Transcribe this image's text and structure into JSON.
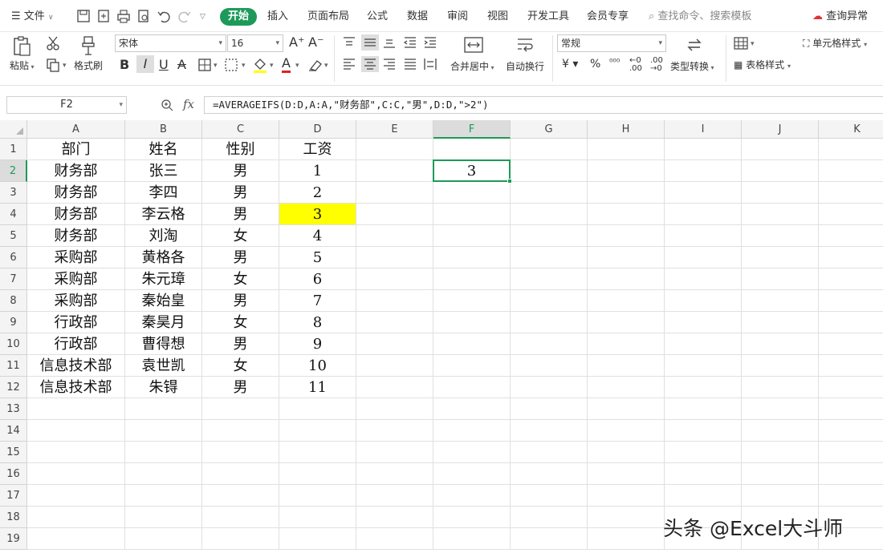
{
  "menubar": {
    "file_label": "文件",
    "tabs": [
      {
        "label": "开始",
        "active": true
      },
      {
        "label": "插入",
        "active": false
      },
      {
        "label": "页面布局",
        "active": false
      },
      {
        "label": "公式",
        "active": false
      },
      {
        "label": "数据",
        "active": false
      },
      {
        "label": "审阅",
        "active": false
      },
      {
        "label": "视图",
        "active": false
      },
      {
        "label": "开发工具",
        "active": false
      },
      {
        "label": "会员专享",
        "active": false
      }
    ],
    "search_placeholder": "查找命令、搜索模板",
    "query_label": "查询异常"
  },
  "ribbon": {
    "paste_label": "粘贴",
    "format_painter_label": "格式刷",
    "font_name": "宋体",
    "font_size": "16",
    "merge_label": "合并居中",
    "wrap_label": "自动换行",
    "number_format": "常规",
    "type_convert_label": "类型转换",
    "cell_style_label": "单元格样式",
    "table_style_label": "表格样式",
    "accent_color": "#1d9a5a",
    "highlight_color": "#ffff00",
    "font_color": "#e02020"
  },
  "formula_bar": {
    "name_box": "F2",
    "fx_label": "fx",
    "formula": "=AVERAGEIFS(D:D,A:A,\"财务部\",C:C,\"男\",D:D,\">2\")"
  },
  "sheet": {
    "columns": [
      "A",
      "B",
      "C",
      "D",
      "E",
      "F",
      "G",
      "H",
      "I",
      "J",
      "K"
    ],
    "selected_column": "F",
    "selected_row": 2,
    "row_numbers": [
      "1",
      "2",
      "3",
      "4",
      "5",
      "6",
      "7",
      "8",
      "9",
      "10",
      "11",
      "12",
      "13",
      "14",
      "15",
      "16",
      "17",
      "18",
      "19"
    ],
    "rows": [
      {
        "a": "部门",
        "b": "姓名",
        "c": "性别",
        "d": "工资",
        "f": ""
      },
      {
        "a": "财务部",
        "b": "张三",
        "c": "男",
        "d": "1",
        "f": "3"
      },
      {
        "a": "财务部",
        "b": "李四",
        "c": "男",
        "d": "2",
        "f": ""
      },
      {
        "a": "财务部",
        "b": "李云格",
        "c": "男",
        "d": "3",
        "f": ""
      },
      {
        "a": "财务部",
        "b": "刘淘",
        "c": "女",
        "d": "4",
        "f": ""
      },
      {
        "a": "采购部",
        "b": "黄格各",
        "c": "男",
        "d": "5",
        "f": ""
      },
      {
        "a": "采购部",
        "b": "朱元璋",
        "c": "女",
        "d": "6",
        "f": ""
      },
      {
        "a": "采购部",
        "b": "秦始皇",
        "c": "男",
        "d": "7",
        "f": ""
      },
      {
        "a": "行政部",
        "b": "秦昊月",
        "c": "女",
        "d": "8",
        "f": ""
      },
      {
        "a": "行政部",
        "b": "曹得想",
        "c": "男",
        "d": "9",
        "f": ""
      },
      {
        "a": "信息技术部",
        "b": "袁世凯",
        "c": "女",
        "d": "10",
        "f": ""
      },
      {
        "a": "信息技术部",
        "b": "朱锝",
        "c": "男",
        "d": "11",
        "f": ""
      }
    ],
    "highlighted_cell": "D4"
  },
  "watermark": "头条 @Excel大斗师"
}
